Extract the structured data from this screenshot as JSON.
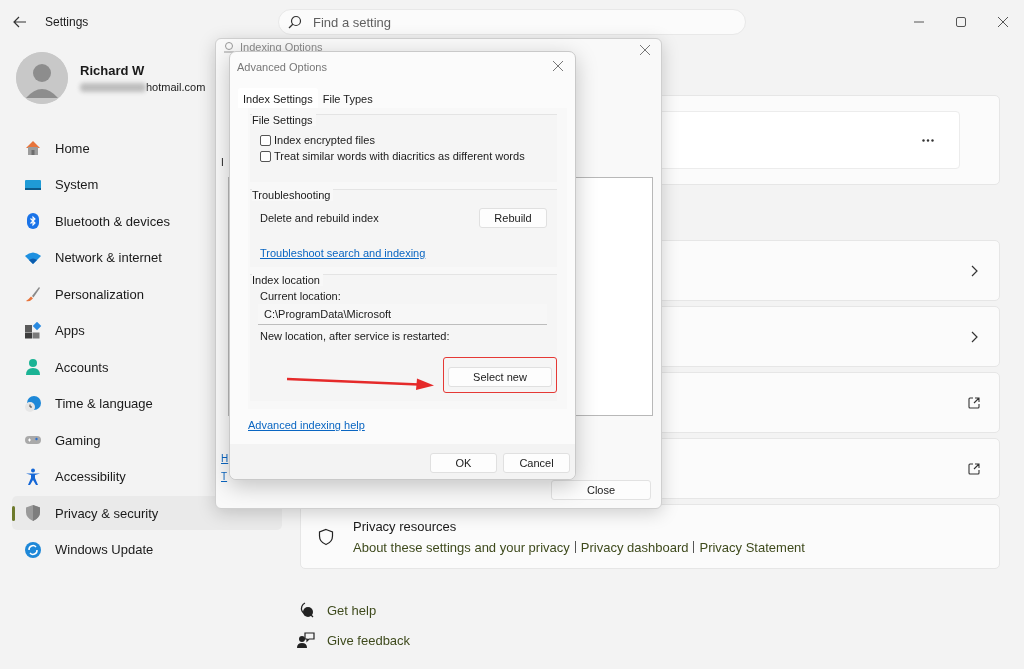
{
  "window": {
    "title": "Settings",
    "search_placeholder": "Find a setting"
  },
  "account": {
    "name": "Richard W",
    "email": "hotmail.com"
  },
  "nav": [
    {
      "label": "Home",
      "selected": false
    },
    {
      "label": "System",
      "selected": false
    },
    {
      "label": "Bluetooth & devices",
      "selected": false
    },
    {
      "label": "Network & internet",
      "selected": false
    },
    {
      "label": "Personalization",
      "selected": false
    },
    {
      "label": "Apps",
      "selected": false
    },
    {
      "label": "Accounts",
      "selected": false
    },
    {
      "label": "Time & language",
      "selected": false
    },
    {
      "label": "Gaming",
      "selected": false
    },
    {
      "label": "Accessibility",
      "selected": false
    },
    {
      "label": "Privacy & security",
      "selected": true
    },
    {
      "label": "Windows Update",
      "selected": false
    }
  ],
  "cards": [
    {
      "kind": "more"
    },
    {
      "kind": "chevron"
    },
    {
      "kind": "chevron"
    },
    {
      "kind": "external"
    },
    {
      "kind": "external"
    }
  ],
  "privacy_resources": {
    "title": "Privacy resources",
    "links": [
      "About these settings and your privacy",
      "Privacy dashboard",
      "Privacy Statement"
    ]
  },
  "help_links": [
    "Get help",
    "Give feedback"
  ],
  "indexing_dialog": {
    "title": "Indexing Options",
    "fragments": [
      {
        "text": "I",
        "kind": "text"
      },
      {
        "text": "H",
        "kind": "link"
      },
      {
        "text": "T",
        "kind": "link"
      }
    ],
    "close_button": "Close"
  },
  "advanced_dialog": {
    "title": "Advanced Options",
    "tabs": [
      {
        "label": "Index Settings",
        "selected": true
      },
      {
        "label": "File Types",
        "selected": false
      }
    ],
    "file_settings": {
      "title": "File Settings",
      "options": [
        {
          "label": "Index encrypted files",
          "checked": false
        },
        {
          "label": "Treat similar words with diacritics as different words",
          "checked": false
        }
      ]
    },
    "troubleshooting": {
      "title": "Troubleshooting",
      "rebuild_label": "Delete and rebuild index",
      "rebuild_button": "Rebuild",
      "link": "Troubleshoot search and indexing"
    },
    "index_location": {
      "title": "Index location",
      "current_label": "Current location:",
      "current_value": "C:\\ProgramData\\Microsoft",
      "new_label": "New location, after service is restarted:",
      "select_button": "Select new",
      "highlighted": true
    },
    "help_link": "Advanced indexing help",
    "buttons": [
      "OK",
      "Cancel"
    ]
  }
}
